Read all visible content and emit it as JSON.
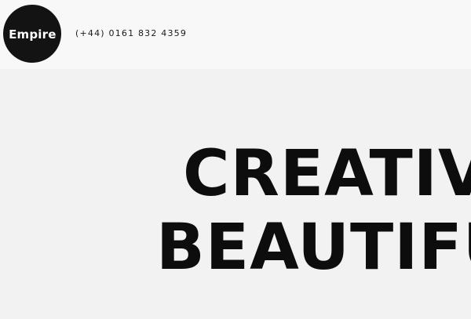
{
  "header": {
    "logo_text": "Empire",
    "phone": "(+44) 0161 832 4359"
  },
  "hero": {
    "line1": "CREATIVE",
    "line2": "BEAUTIFUL"
  },
  "colors": {
    "background": "#f2f2f2",
    "header_background": "#f8f8f8",
    "logo_background": "#131313",
    "text": "#0d0d0d"
  }
}
